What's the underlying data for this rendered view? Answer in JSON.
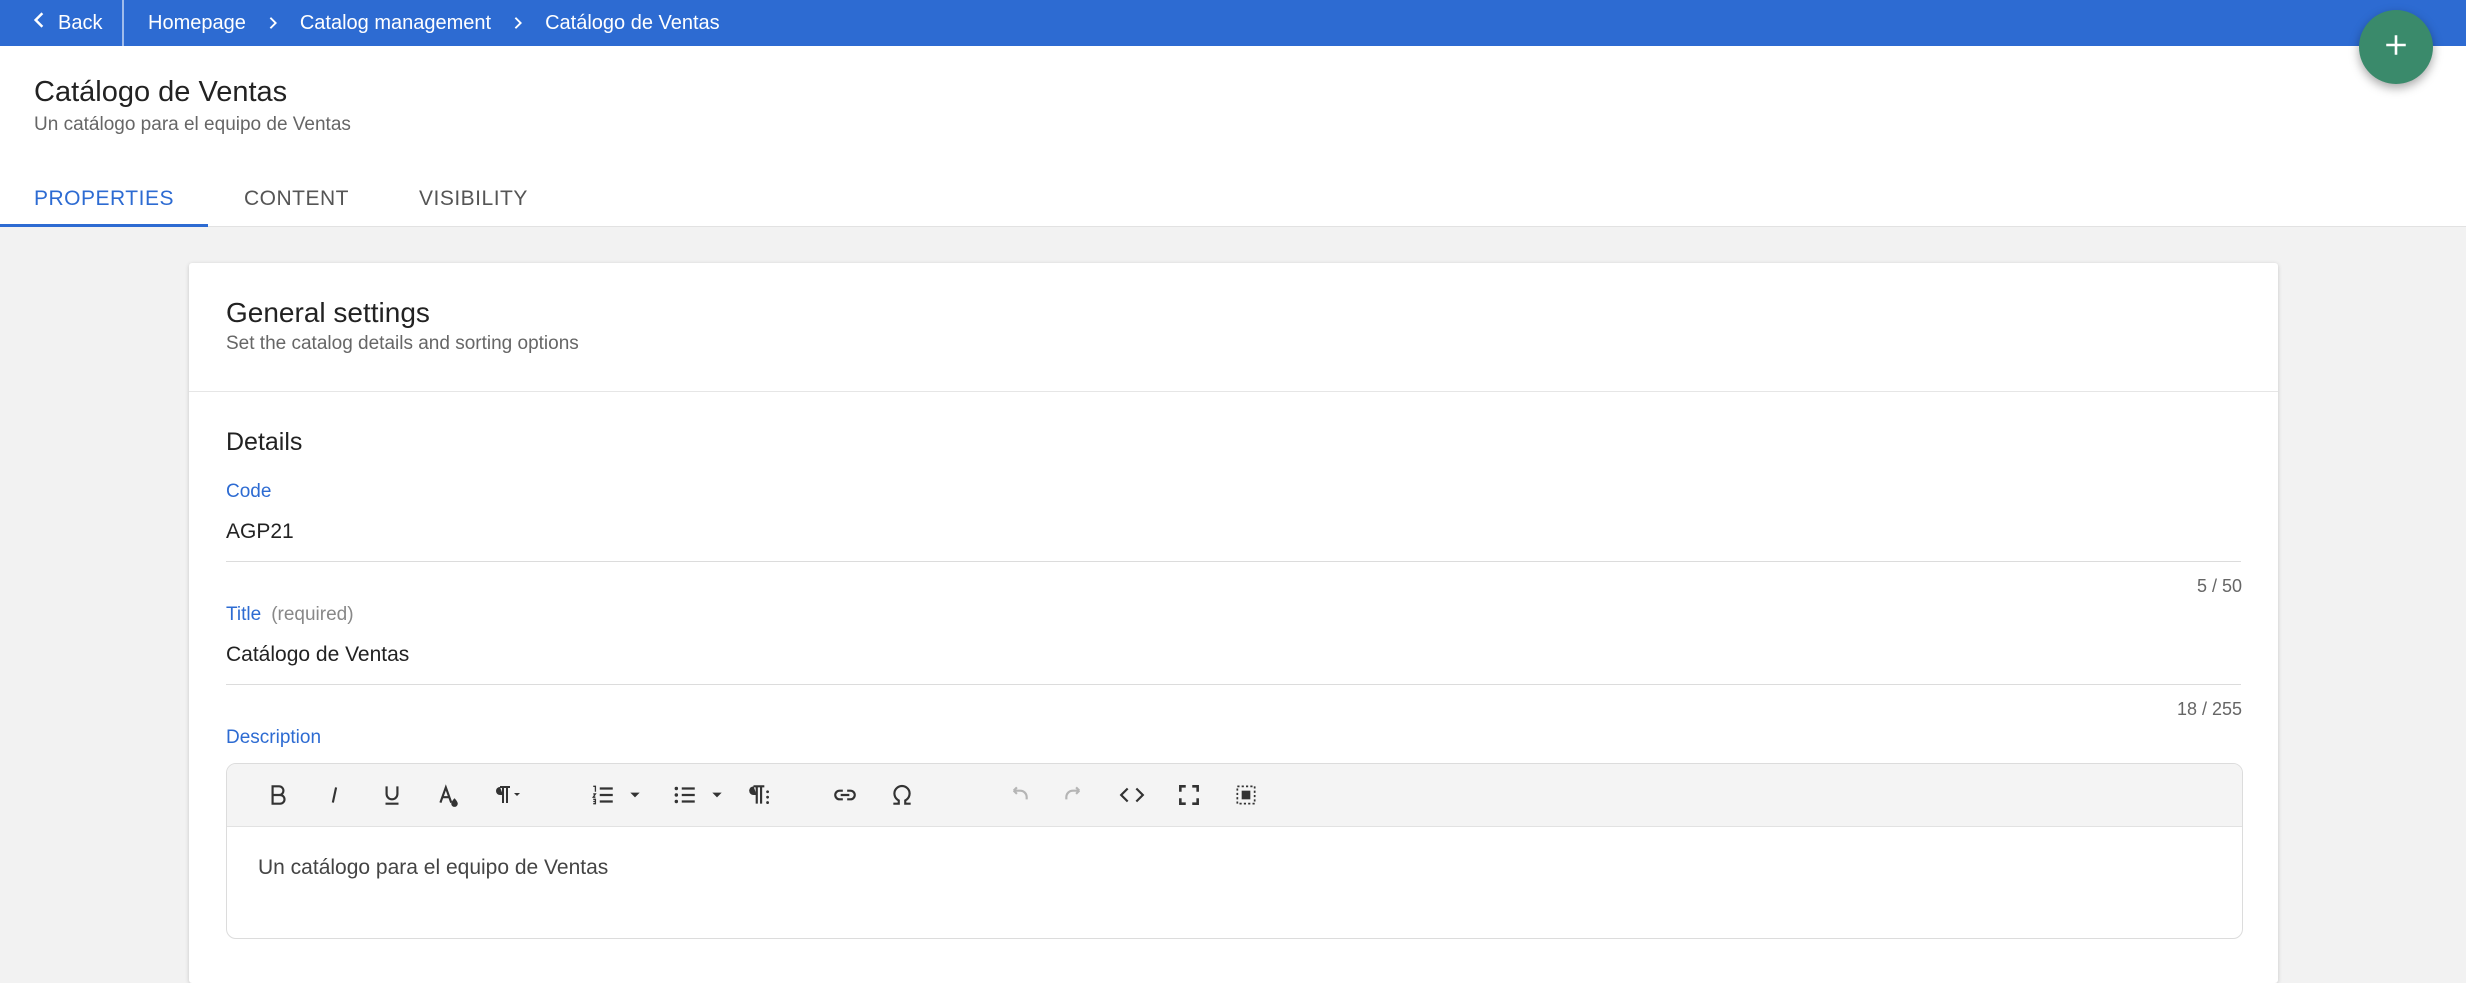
{
  "topbar": {
    "back_label": "Back",
    "breadcrumbs": [
      "Homepage",
      "Catalog management",
      "Catálogo de Ventas"
    ]
  },
  "header": {
    "title": "Catálogo de Ventas",
    "subtitle": "Un catálogo para el equipo de Ventas",
    "tabs": [
      {
        "label": "PROPERTIES",
        "active": true
      },
      {
        "label": "CONTENT",
        "active": false
      },
      {
        "label": "VISIBILITY",
        "active": false
      }
    ]
  },
  "card": {
    "title": "General settings",
    "subtitle": "Set the catalog details and sorting options",
    "section_title": "Details",
    "code": {
      "label": "Code",
      "value": "AGP21",
      "counter": "5 / 50"
    },
    "title_field": {
      "label": "Title",
      "required": "(required)",
      "value": "Catálogo de Ventas",
      "counter": "18 / 255"
    },
    "description": {
      "label": "Description",
      "value": "Un catálogo para el equipo de Ventas",
      "toolbar_icons": [
        "bold-icon",
        "italic-icon",
        "underline-icon",
        "text-color-icon",
        "paragraph-format-icon",
        "ordered-list-icon",
        "unordered-list-icon",
        "paragraph-style-icon",
        "link-icon",
        "special-character-icon",
        "undo-icon",
        "redo-icon",
        "code-view-icon",
        "fullscreen-icon",
        "select-all-icon"
      ]
    }
  },
  "colors": {
    "topbar": "#2d6bd2",
    "accent": "#2d6bd2",
    "fab": "#3a8a6b"
  }
}
